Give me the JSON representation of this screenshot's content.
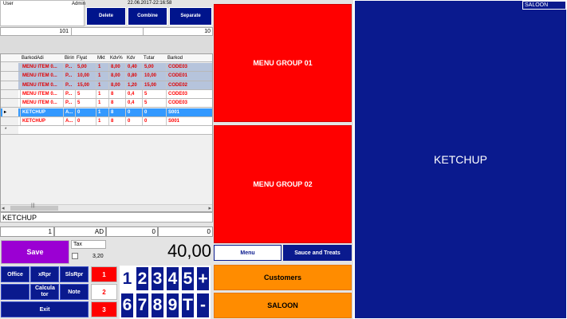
{
  "header": {
    "user_label": "User",
    "user_name": "Admin",
    "datetime": "22.06.2017-22:16:58",
    "delete_label": "Delete",
    "combine_label": "Combine",
    "separate_label": "Separate"
  },
  "summary_row": {
    "left": "101",
    "right": "10"
  },
  "table": {
    "columns": [
      "BarkodAdi",
      "Birim",
      "Fiyat",
      "Mkt",
      "Kdv%",
      "Kdv",
      "Tutar",
      "Barkod"
    ],
    "rows": [
      {
        "name": "MENU ITEM 0...",
        "unit": "P...",
        "price": "5,00",
        "qty": "1",
        "kdvp": "8,00",
        "kdv": "0,40",
        "total": "5,00",
        "code": "CODE03",
        "style": "grey"
      },
      {
        "name": "MENU ITEM 0...",
        "unit": "P...",
        "price": "10,00",
        "qty": "1",
        "kdvp": "8,00",
        "kdv": "0,80",
        "total": "10,00",
        "code": "CODE01",
        "style": "grey"
      },
      {
        "name": "MENU ITEM 0...",
        "unit": "P...",
        "price": "15,00",
        "qty": "1",
        "kdvp": "8,00",
        "kdv": "1,20",
        "total": "15,00",
        "code": "CODE02",
        "style": "grey"
      },
      {
        "name": "MENU ITEM 0...",
        "unit": "P...",
        "price": "5",
        "qty": "1",
        "kdvp": "8",
        "kdv": "0,4",
        "total": "5",
        "code": "CODE03",
        "style": "white"
      },
      {
        "name": "MENU ITEM 0...",
        "unit": "P...",
        "price": "5",
        "qty": "1",
        "kdvp": "8",
        "kdv": "0,4",
        "total": "5",
        "code": "CODE03",
        "style": "white"
      },
      {
        "name": "KETCHUP",
        "unit": "A...",
        "price": "0",
        "qty": "1",
        "kdvp": "8",
        "kdv": "0",
        "total": "0",
        "code": "S001",
        "style": "selected"
      },
      {
        "name": "KETCHUP",
        "unit": "A...",
        "price": "0",
        "qty": "1",
        "kdvp": "8",
        "kdv": "0",
        "total": "0",
        "code": "S001",
        "style": "white"
      }
    ],
    "new_row_marker": "*",
    "current_marker": "▸"
  },
  "selected_item": "KETCHUP",
  "info_row": {
    "qty": "1",
    "unit": "AD",
    "a": "0",
    "b": "0"
  },
  "save_label": "Save",
  "tax_label": "Tax",
  "tax_value": "3,20",
  "total": "40,00",
  "action_buttons": {
    "office": "Office",
    "xrpr": "xRpr",
    "slsrpr": "SlsRpr",
    "calculator": "Calcula tor",
    "note": "Note",
    "exit": "Exit"
  },
  "multipliers": [
    "1",
    "2",
    "3"
  ],
  "keypad_top": [
    "1",
    "2",
    "3",
    "4",
    "5",
    "+"
  ],
  "keypad_bottom": [
    "6",
    "7",
    "8",
    "9",
    "T",
    "-"
  ],
  "menu_groups": [
    "MENU GROUP 01",
    "MENU GROUP 02"
  ],
  "tabs": {
    "menu": "Menu",
    "sauce": "Sauce and Treats"
  },
  "customers_label": "Customers",
  "saloon_button": "SALOON",
  "right_panel": {
    "badge": "SALOON",
    "item": "KETCHUP"
  },
  "colors": {
    "navy": "#00148c",
    "red": "#ff0000",
    "orange": "#ff8c00",
    "purple": "#9b00d3",
    "selected_row": "#3399ff",
    "grey_row": "#b6c4dc"
  }
}
